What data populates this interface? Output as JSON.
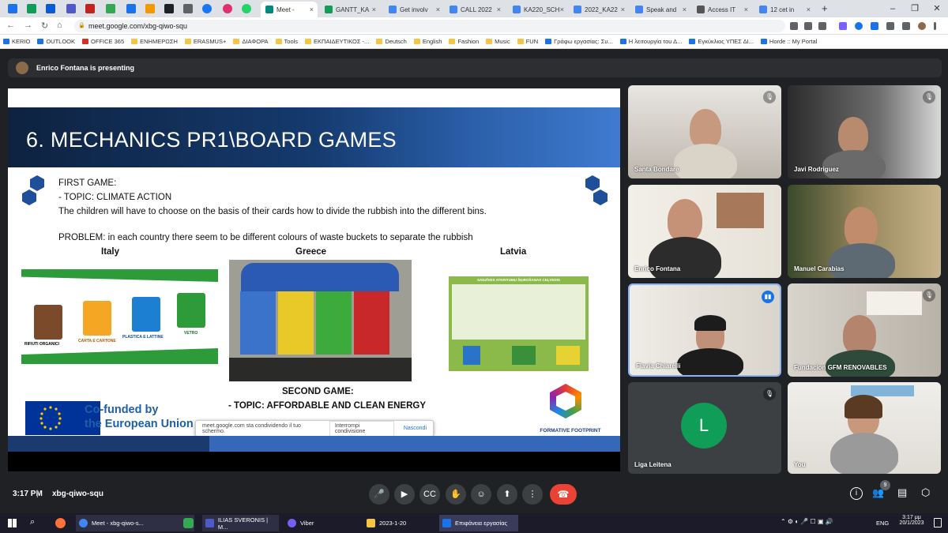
{
  "browser": {
    "tabs": [
      {
        "label": "Meet -",
        "color": "#00897b",
        "active": true
      },
      {
        "label": "GANTT_KA",
        "color": "#0f9d58"
      },
      {
        "label": "Get involv",
        "color": "#4285f4"
      },
      {
        "label": "CALL 2022",
        "color": "#4285f4"
      },
      {
        "label": "KA220_SCH",
        "color": "#4285f4"
      },
      {
        "label": "2022_KA22",
        "color": "#4285f4"
      },
      {
        "label": "Speak and",
        "color": "#4285f4"
      },
      {
        "label": "Access IT",
        "color": "#555555"
      },
      {
        "label": "12 cet in",
        "color": "#4285f4"
      }
    ],
    "url": "meet.google.com/xbg-qiwo-squ",
    "bookmarks": [
      "KERIO",
      "OUTLOOK",
      "OFFICE 365",
      "ΕΝΗΜΕΡΩΣΗ",
      "ERASMUS+",
      "ΔΙΑΦΟΡΑ",
      "Tools",
      "ΕΚΠΑΙΔΕΥΤΙΚΟΣ -...",
      "Deutsch",
      "English",
      "Fashion",
      "Music",
      "FUN",
      "Γράφω εργασίας: Συ...",
      "Η λειτουργία του Δ...",
      "Εγκύκλιος ΥΠΕΣ ΔΙ...",
      "Horde :: My Portal"
    ]
  },
  "meet": {
    "presenting": "Enrico Fontana is presenting",
    "time": "3:17 PM",
    "code": "xbg-qiwo-squ",
    "participants_count": "9"
  },
  "slide": {
    "title": "6. MECHANICS PR1\\BOARD GAMES",
    "first_game": "FIRST GAME:",
    "topic1": "-    TOPIC: CLIMATE ACTION",
    "desc": "The children will have to choose on the basis of their cards how to divide the rubbish into the different bins.",
    "problem": "PROBLEM: in each country there seem to be different colours of waste buckets to separate the rubbish",
    "countries": [
      "Italy",
      "Greece",
      "Latvia"
    ],
    "italy_bins": [
      "RIFIUTI ORGANICI",
      "CARTA E CARTONE",
      "PLASTICA E LATTINE",
      "VETRO"
    ],
    "latvia_heading": "SADZĪVES ATKRITUMU ŠĶIROŠANAS CEĻVEDIS",
    "second_game": "SECOND GAME:",
    "topic2": "- TOPIC: AFFORDABLE AND CLEAN ENERGY",
    "cofunded_1": "Co-funded by",
    "cofunded_2": "the European Union",
    "logo_text": "FORMATIVE FOOTPRINT",
    "share_notice": "meet.google.com sta condividendo il tuo schermo.",
    "share_stop": "Interrompi condivisione",
    "share_hide": "Nascondi"
  },
  "tiles": [
    {
      "name": "Santa Bondare",
      "muted": true
    },
    {
      "name": "Javi Rodriguez",
      "muted": true
    },
    {
      "name": "Enrico Fontana",
      "muted": false
    },
    {
      "name": "Manuel Carabias",
      "muted": false
    },
    {
      "name": "Flavia Chiarelli",
      "muted": false,
      "speaking": true
    },
    {
      "name": "Fundacion GFM RENOVABLES",
      "muted": true
    },
    {
      "name": "Liga Leitena",
      "muted": true,
      "initial": "L"
    },
    {
      "name": "You",
      "muted": false
    }
  ],
  "taskbar": {
    "items": [
      "Meet - xbg-qiwo-s...",
      "ILIAS SVERONIS | M...",
      "Viber",
      "2023-1-20",
      "Επιφάνεια εργασίας"
    ],
    "lang": "ENG",
    "clock_time": "3:17 μμ",
    "clock_date": "20/1/2023"
  },
  "colors": {
    "accent": "#1a73e8",
    "end_call": "#ea4335",
    "speaking_border": "#8ab4f8",
    "slide_header": "#153a6e"
  }
}
